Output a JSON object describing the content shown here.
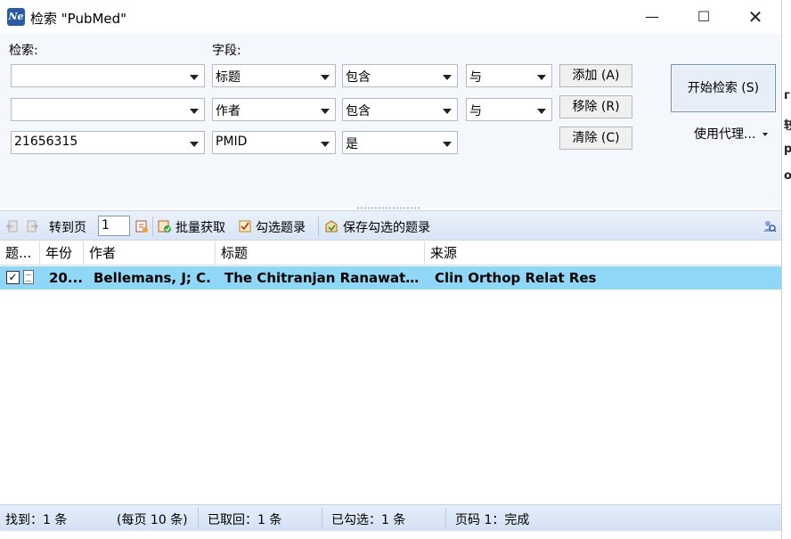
{
  "window": {
    "title": "检索 \"PubMed\"",
    "icon_text": "Ne",
    "minimize": "—",
    "maximize": "☐",
    "close": "✕"
  },
  "search": {
    "label_search": "检索:",
    "label_field": "字段:",
    "rows": [
      {
        "term": "",
        "field": "标题",
        "operator": "包含",
        "logic": "与"
      },
      {
        "term": "",
        "field": "作者",
        "operator": "包含",
        "logic": "与"
      },
      {
        "term": "21656315",
        "field": "PMID",
        "operator": "是"
      }
    ],
    "add_label": "添加 (A)",
    "remove_label": "移除 (R)",
    "clear_label": "清除 (C)",
    "start_label": "开始检索 (S)",
    "proxy_label": "使用代理..."
  },
  "toolbar": {
    "goto_label": "转到页",
    "page_value": "1",
    "batch_label": "批量获取",
    "check_label": "勾选题录",
    "save_label": "保存勾选的题录"
  },
  "grid": {
    "columns": [
      "题...",
      "年份",
      "作者",
      "标题",
      "来源"
    ],
    "rows": [
      {
        "checked": "✓",
        "year": "20...",
        "author": "Bellemans, J; C.",
        "title": "The Chitranjan Ranawat a...",
        "source": "Clin Orthop Relat Res"
      }
    ]
  },
  "status": {
    "found": "找到：1 条",
    "per_page": "(每页 10 条)",
    "retrieved": "已取回：1 条",
    "checked": "已勾选：1 条",
    "page": "页码 1：完成"
  },
  "colors": {
    "selected_row": "#8fd7f7",
    "panel_bg": "#f4f7fc",
    "toolbar_bg": "#dce7f6"
  }
}
